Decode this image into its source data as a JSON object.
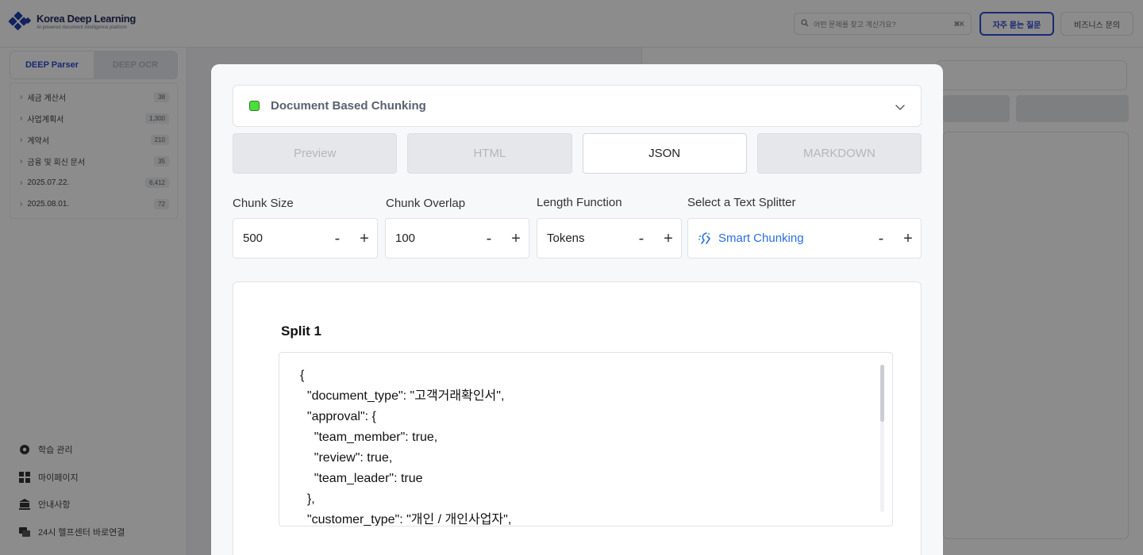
{
  "app": {
    "logo_title": "Korea Deep Learning",
    "logo_sub": "AI-powered document intelligence platform",
    "search_placeholder": "어떤 문제를 찾고 계신가요?",
    "search_shortcut": "⌘K",
    "faq_button": "자주 묻는 질문",
    "biz_button": "비즈니스 문의"
  },
  "sidebar": {
    "tabs": [
      {
        "label": "DEEP Parser"
      },
      {
        "label": "DEEP OCR"
      }
    ],
    "folders": [
      {
        "label": "세금 계산서",
        "count": "38"
      },
      {
        "label": "사업계획서",
        "count": "1,300"
      },
      {
        "label": "계약서",
        "count": "210"
      },
      {
        "label": "금융 및 회신 문서",
        "count": "35"
      },
      {
        "label": "2025.07.22.",
        "count": "6,412"
      },
      {
        "label": "2025.08.01.",
        "count": "72"
      }
    ],
    "bottom_links": [
      {
        "label": "학습 관리",
        "icon": "gear-icon"
      },
      {
        "label": "마이페이지",
        "icon": "grid-icon"
      },
      {
        "label": "안내사항",
        "icon": "bank-icon"
      },
      {
        "label": "24시 헬프센터 바로연결",
        "icon": "chat-icon"
      }
    ]
  },
  "modal": {
    "dropdown_label": "Document Based Chunking",
    "tabs": [
      {
        "label": "Preview",
        "active": false
      },
      {
        "label": "HTML",
        "active": false
      },
      {
        "label": "JSON",
        "active": true
      },
      {
        "label": "MARKDOWN",
        "active": false
      }
    ],
    "controls": {
      "chunk_size": {
        "label": "Chunk Size",
        "value": "500"
      },
      "chunk_overlap": {
        "label": "Chunk Overlap",
        "value": "100"
      },
      "length_function": {
        "label": "Length Function",
        "value": "Tokens"
      },
      "text_splitter": {
        "label": "Select a Text Splitter",
        "value": "Smart Chunking"
      }
    },
    "minus": "-",
    "plus": "+",
    "split_title": "Split 1",
    "code_text": "{\n  \"document_type\": \"고객거래확인서\",\n  \"approval\": {\n    \"team_member\": true,\n    \"review\": true,\n    \"team_leader\": true\n  },\n  \"customer_type\": \"개인 / 개인사업자\","
  },
  "colors": {
    "accent_blue": "#2c4bd8",
    "splitter_blue": "#2a6ee0",
    "status_green": "#4ade3a"
  }
}
